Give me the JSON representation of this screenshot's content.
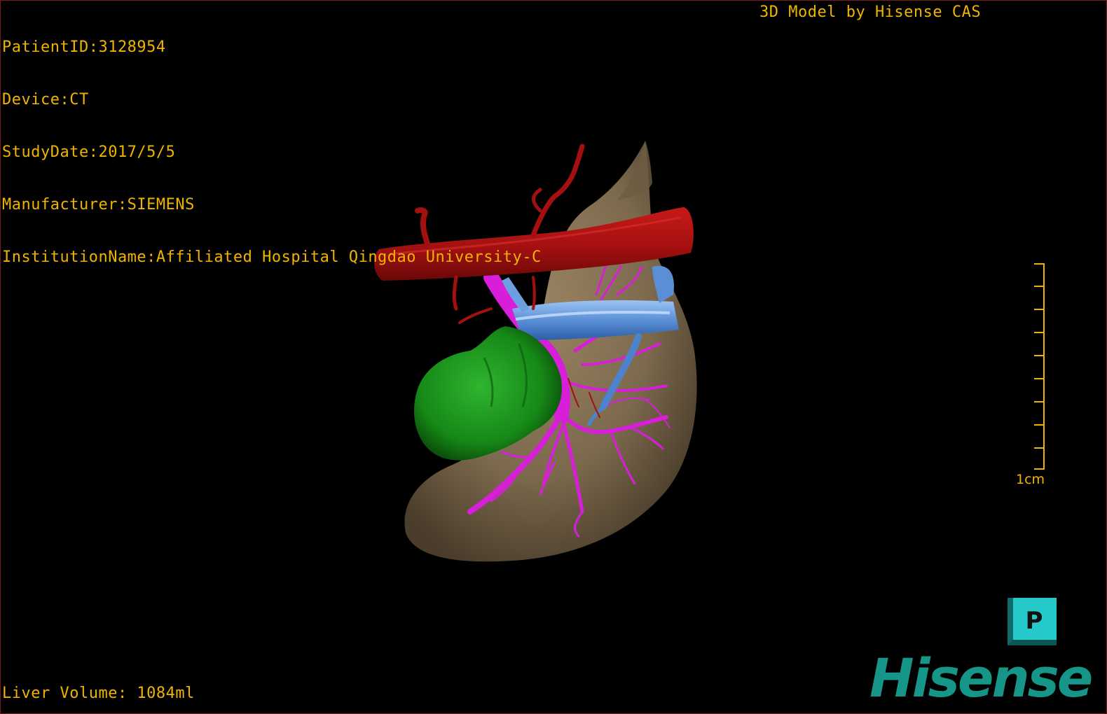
{
  "overlay": {
    "patient_id": "PatientID:3128954",
    "device": "Device:CT",
    "study_date": "StudyDate:2017/5/5",
    "manufacturer": "Manufacturer:SIEMENS",
    "institution": "InstitutionName:Affiliated Hospital Qingdao University-C",
    "brand_text": "3D Model by Hisense CAS",
    "liver_volume": "Liver Volume: 1084ml",
    "scale_label": "1cm"
  },
  "orientation_cube": {
    "face_letter": "P"
  },
  "logo": {
    "text": "Hisense"
  },
  "colors": {
    "overlay_text": "#f0b400",
    "liver": "#7d6a4e",
    "artery": "#b51414",
    "portal_vein": "#5a8fd6",
    "hepatic_vein": "#d81ed8",
    "tumor": "#1a8c1a",
    "cube": "#26c9c9",
    "logo": "#169688",
    "border": "#7a1a1a"
  }
}
